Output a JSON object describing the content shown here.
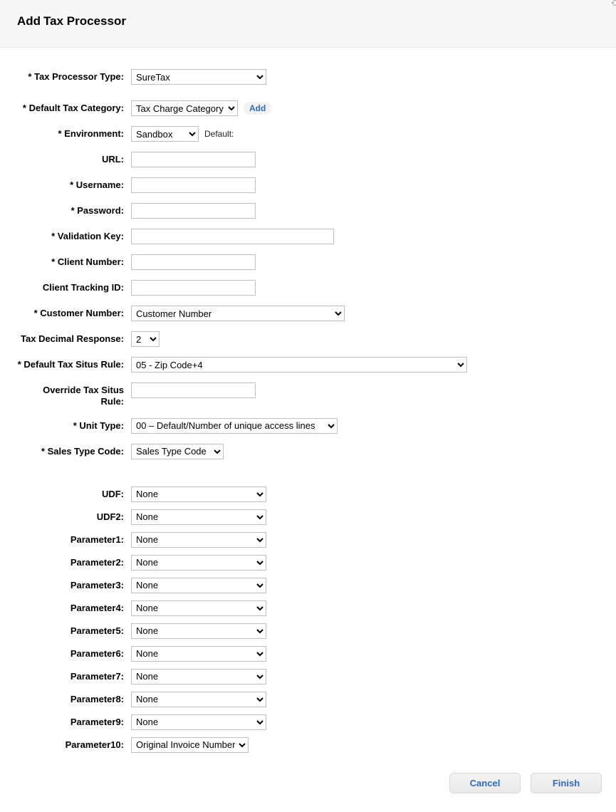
{
  "header": {
    "title_bold": "Add",
    "title_rest": "Tax Processor"
  },
  "labels": {
    "tax_processor_type": "* Tax Processor Type:",
    "default_tax_category": "* Default Tax Category:",
    "environment": "* Environment:",
    "environment_hint": "Default:",
    "url": "URL:",
    "username": "* Username:",
    "password": "* Password:",
    "validation_key": "* Validation Key:",
    "client_number": "* Client Number:",
    "client_tracking_id": "Client Tracking ID:",
    "customer_number": "* Customer Number:",
    "tax_decimal_response": "Tax Decimal Response:",
    "default_tax_situs_rule": "* Default Tax Situs Rule:",
    "override_tax_situs_rule": "Override Tax Situs Rule:",
    "unit_type": "* Unit Type:",
    "sales_type_code": "* Sales Type Code:",
    "udf": "UDF:",
    "udf2": "UDF2:",
    "parameter1": "Parameter1:",
    "parameter2": "Parameter2:",
    "parameter3": "Parameter3:",
    "parameter4": "Parameter4:",
    "parameter5": "Parameter5:",
    "parameter6": "Parameter6:",
    "parameter7": "Parameter7:",
    "parameter8": "Parameter8:",
    "parameter9": "Parameter9:",
    "parameter10": "Parameter10:"
  },
  "values": {
    "tax_processor_type": "SureTax",
    "default_tax_category": "Tax Charge Category",
    "add_link": "Add",
    "environment": "Sandbox",
    "url": "",
    "username": "",
    "password": "",
    "validation_key": "",
    "client_number": "",
    "client_tracking_id": "",
    "customer_number": "Customer Number",
    "tax_decimal_response": "2",
    "default_tax_situs_rule": "05 - Zip Code+4",
    "override_tax_situs_rule": "",
    "unit_type": "00 – Default/Number of unique access lines",
    "sales_type_code": "Sales Type Code",
    "udf": "None",
    "udf2": "None",
    "parameter1": "None",
    "parameter2": "None",
    "parameter3": "None",
    "parameter4": "None",
    "parameter5": "None",
    "parameter6": "None",
    "parameter7": "None",
    "parameter8": "None",
    "parameter9": "None",
    "parameter10": "Original Invoice Number"
  },
  "buttons": {
    "cancel": "Cancel",
    "finish": "Finish"
  }
}
